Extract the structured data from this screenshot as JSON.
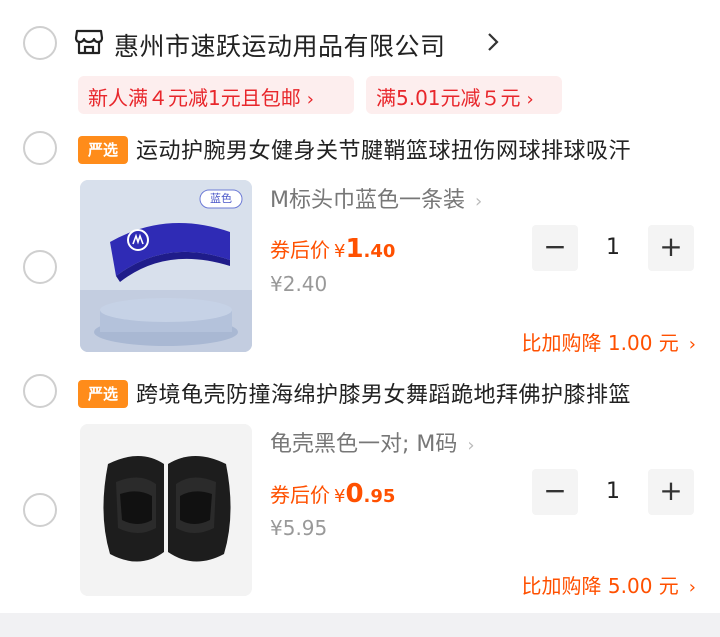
{
  "shop": {
    "name": "惠州市速跃运动用品有限公司",
    "icon": "shop-icon"
  },
  "coupons": [
    {
      "label": "新人满４元减1元且包邮"
    },
    {
      "label": "满5.01元减５元"
    }
  ],
  "items": [
    {
      "tag": "严选",
      "title": "运动护腕男女健身关节腱鞘篮球扭伤网球排球吸汗",
      "variant": "M标头巾蓝色一条装",
      "thumb_badge": "蓝色",
      "price_label": "券后价",
      "price_yen": "¥",
      "price_int": "1",
      "price_dec": ".40",
      "original_price": "¥2.40",
      "quantity": "1",
      "promo": "比加购降 1.00 元"
    },
    {
      "tag": "严选",
      "title": "跨境龟壳防撞海绵护膝男女舞蹈跪地拜佛护膝排篮",
      "variant": "龟壳黑色一对; M码",
      "price_label": "券后价",
      "price_yen": "¥",
      "price_int": "0",
      "price_dec": ".95",
      "original_price": "¥5.95",
      "quantity": "1",
      "promo": "比加购降 5.00 元"
    }
  ],
  "colors": {
    "accent": "#ff5000",
    "coupon_text": "#e8262b",
    "coupon_bg": "#fdeeee",
    "tag_bg": "#ff8c1a"
  }
}
